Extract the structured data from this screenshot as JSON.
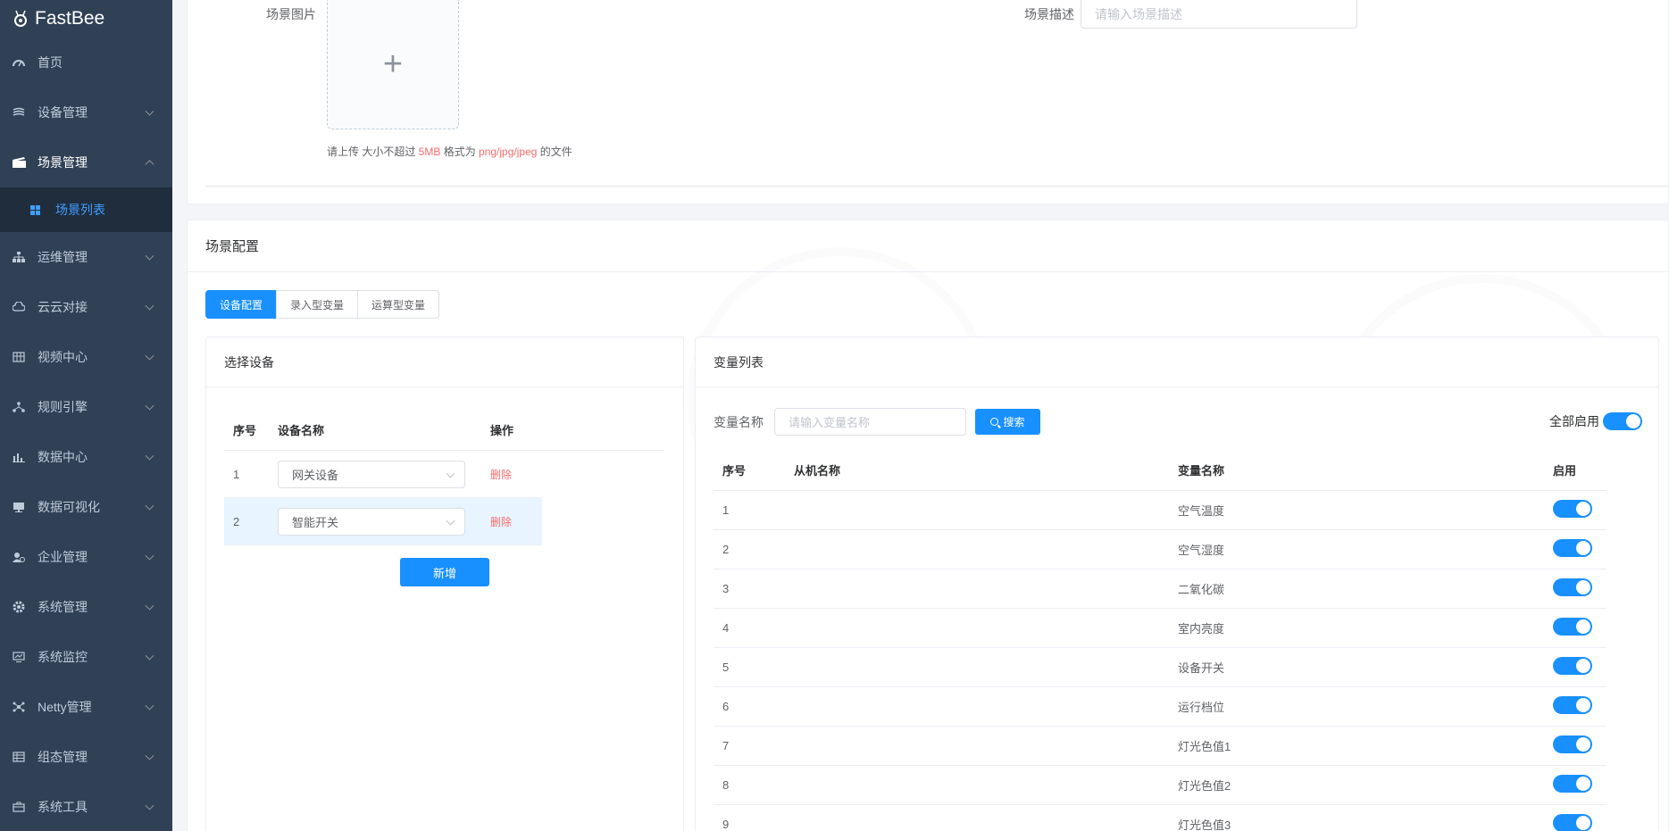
{
  "app": {
    "title": "FastBee"
  },
  "sidebar": {
    "items": [
      {
        "label": "首页",
        "icon": "dashboard-icon",
        "has_children": false
      },
      {
        "label": "设备管理",
        "icon": "device-icon",
        "has_children": true
      },
      {
        "label": "场景管理",
        "icon": "scene-icon",
        "has_children": true,
        "open": true,
        "children": [
          {
            "label": "场景列表",
            "icon": "grid-icon",
            "active": true
          }
        ]
      },
      {
        "label": "运维管理",
        "icon": "tree-icon",
        "has_children": true
      },
      {
        "label": "云云对接",
        "icon": "cloud-icon",
        "has_children": true
      },
      {
        "label": "视频中心",
        "icon": "video-icon",
        "has_children": true
      },
      {
        "label": "规则引擎",
        "icon": "rule-icon",
        "has_children": true
      },
      {
        "label": "数据中心",
        "icon": "chart-icon",
        "has_children": true
      },
      {
        "label": "数据可视化",
        "icon": "monitor-icon",
        "has_children": true
      },
      {
        "label": "企业管理",
        "icon": "enterprise-icon",
        "has_children": true
      },
      {
        "label": "系统管理",
        "icon": "gear-icon",
        "has_children": true
      },
      {
        "label": "系统监控",
        "icon": "screen-icon",
        "has_children": true
      },
      {
        "label": "Netty管理",
        "icon": "network-icon",
        "has_children": true
      },
      {
        "label": "组态管理",
        "icon": "config-icon",
        "has_children": true
      },
      {
        "label": "系统工具",
        "icon": "toolbox-icon",
        "has_children": true
      }
    ]
  },
  "top_form": {
    "image_label": "场景图片",
    "upload_tip": {
      "prefix": "请上传 大小不超过 ",
      "size": "5MB",
      "middle": " 格式为 ",
      "formats": "png/jpg/jpeg",
      "suffix": " 的文件"
    },
    "desc_label": "场景描述",
    "desc_placeholder": "请输入场景描述"
  },
  "scene_config": {
    "title": "场景配置",
    "tabs": [
      {
        "label": "设备配置",
        "active": true
      },
      {
        "label": "录入型变量",
        "active": false
      },
      {
        "label": "运算型变量",
        "active": false
      }
    ],
    "device_panel": {
      "title": "选择设备",
      "columns": {
        "index": "序号",
        "name": "设备名称",
        "action": "操作"
      },
      "rows": [
        {
          "index": "1",
          "device": "网关设备",
          "action": "删除"
        },
        {
          "index": "2",
          "device": "智能开关",
          "action": "删除"
        }
      ],
      "add_button": "新增"
    },
    "variable_panel": {
      "title": "变量列表",
      "search_label": "变量名称",
      "search_placeholder": "请输入变量名称",
      "search_button": "搜索",
      "enable_all_label": "全部启用",
      "enable_all": true,
      "columns": {
        "index": "序号",
        "slave": "从机名称",
        "name": "变量名称",
        "enabled": "启用"
      },
      "rows": [
        {
          "index": "1",
          "slave": "",
          "name": "空气温度",
          "enabled": true
        },
        {
          "index": "2",
          "slave": "",
          "name": "空气湿度",
          "enabled": true
        },
        {
          "index": "3",
          "slave": "",
          "name": "二氧化碳",
          "enabled": true
        },
        {
          "index": "4",
          "slave": "",
          "name": "室内亮度",
          "enabled": true
        },
        {
          "index": "5",
          "slave": "",
          "name": "设备开关",
          "enabled": true
        },
        {
          "index": "6",
          "slave": "",
          "name": "运行档位",
          "enabled": true
        },
        {
          "index": "7",
          "slave": "",
          "name": "灯光色值1",
          "enabled": true
        },
        {
          "index": "8",
          "slave": "",
          "name": "灯光色值2",
          "enabled": true
        },
        {
          "index": "9",
          "slave": "",
          "name": "灯光色值3",
          "enabled": true
        }
      ]
    }
  },
  "colors": {
    "sidebar_bg": "#304156",
    "primary": "#1890ff",
    "danger": "#f56c6c",
    "submenu_bg": "#1f2d3d"
  }
}
